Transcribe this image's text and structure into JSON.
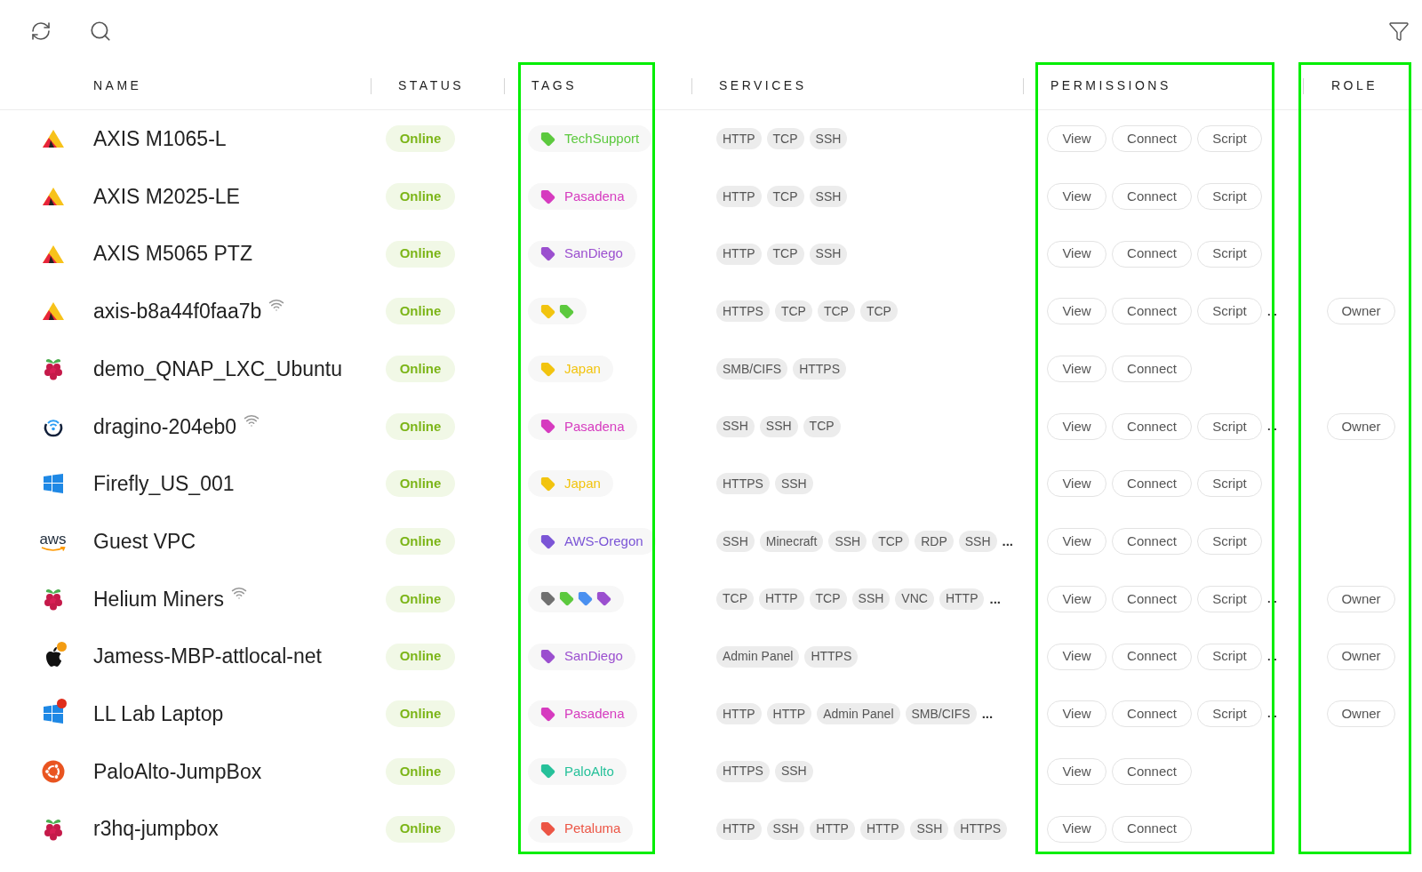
{
  "columns": [
    {
      "label": "NAME",
      "highlighted": false
    },
    {
      "label": "STATUS",
      "highlighted": false
    },
    {
      "label": "TAGS",
      "highlighted": true
    },
    {
      "label": "SERVICES",
      "highlighted": false
    },
    {
      "label": "PERMISSIONS",
      "highlighted": true
    },
    {
      "label": "ROLE",
      "highlighted": true
    }
  ],
  "rows": [
    {
      "kind": "axis",
      "name": "AXIS M1065-L",
      "wireless": false,
      "status": "Online",
      "tags": [
        {
          "label": "TechSupport",
          "color": "#5cc93e"
        }
      ],
      "services": [
        "HTTP",
        "TCP",
        "SSH"
      ],
      "permissions": [
        "View",
        "Connect",
        "Script"
      ]
    },
    {
      "kind": "axis",
      "name": "AXIS M2025-LE",
      "wireless": false,
      "status": "Online",
      "tags": [
        {
          "label": "Pasadena",
          "color": "#d63bbf"
        }
      ],
      "services": [
        "HTTP",
        "TCP",
        "SSH"
      ],
      "permissions": [
        "View",
        "Connect",
        "Script"
      ]
    },
    {
      "kind": "axis",
      "name": "AXIS M5065 PTZ",
      "wireless": false,
      "status": "Online",
      "tags": [
        {
          "label": "SanDiego",
          "color": "#9b4fcf"
        }
      ],
      "services": [
        "HTTP",
        "TCP",
        "SSH"
      ],
      "permissions": [
        "View",
        "Connect",
        "Script"
      ]
    },
    {
      "kind": "axis",
      "name": "axis-b8a44f0faa7b",
      "wireless": true,
      "status": "Online",
      "tags": [
        {
          "color": "#f2c40f"
        },
        {
          "color": "#5cc93e"
        }
      ],
      "services": [
        "HTTPS",
        "TCP",
        "TCP",
        "TCP"
      ],
      "permissions": [
        "View",
        "Connect",
        "Script"
      ],
      "permissions_more": ". .",
      "role": "Owner"
    },
    {
      "kind": "raspberry",
      "name": "demo_QNAP_LXC_Ubuntu",
      "wireless": false,
      "status": "Online",
      "tags": [
        {
          "label": "Japan",
          "color": "#f2c40f"
        }
      ],
      "services": [
        "SMB/CIFS",
        "HTTPS"
      ],
      "permissions": [
        "View",
        "Connect"
      ]
    },
    {
      "kind": "dragino",
      "name": "dragino-204eb0",
      "wireless": true,
      "status": "Online",
      "tags": [
        {
          "label": "Pasadena",
          "color": "#d63bbf"
        }
      ],
      "services": [
        "SSH",
        "SSH",
        "TCP"
      ],
      "permissions": [
        "View",
        "Connect",
        "Script"
      ],
      "permissions_more": ". .",
      "role": "Owner"
    },
    {
      "kind": "windows",
      "name": "Firefly_US_001",
      "wireless": false,
      "status": "Online",
      "tags": [
        {
          "label": "Japan",
          "color": "#f2c40f"
        }
      ],
      "services": [
        "HTTPS",
        "SSH"
      ],
      "permissions": [
        "View",
        "Connect",
        "Script"
      ]
    },
    {
      "kind": "aws",
      "logo_text": "aws",
      "name": "Guest VPC",
      "wireless": false,
      "status": "Online",
      "tags": [
        {
          "label": "AWS-Oregon",
          "color": "#7b55d6"
        }
      ],
      "services": [
        "SSH",
        "Minecraft",
        "SSH",
        "TCP",
        "RDP",
        "SSH"
      ],
      "services_more": "...",
      "permissions": [
        "View",
        "Connect",
        "Script"
      ]
    },
    {
      "kind": "raspberry",
      "name": "Helium Miners",
      "wireless": true,
      "status": "Online",
      "tags": [
        {
          "color": "#707070"
        },
        {
          "color": "#5cc93e"
        },
        {
          "color": "#4a90f0"
        },
        {
          "color": "#9b4fcf"
        }
      ],
      "services": [
        "TCP",
        "HTTP",
        "TCP",
        "SSH",
        "VNC",
        "HTTP"
      ],
      "services_more": "...",
      "permissions": [
        "View",
        "Connect",
        "Script"
      ],
      "permissions_more": ". .",
      "role": "Owner"
    },
    {
      "kind": "apple",
      "color": "#f39c12",
      "name": "Jamess-MBP-attlocal-net",
      "wireless": false,
      "status": "Online",
      "tags": [
        {
          "label": "SanDiego",
          "color": "#9b4fcf"
        }
      ],
      "services": [
        "Admin Panel",
        "HTTPS"
      ],
      "permissions": [
        "View",
        "Connect",
        "Script"
      ],
      "permissions_more": ". .",
      "role": "Owner"
    },
    {
      "kind": "windows",
      "color": "#e02d1b",
      "name": "LL Lab Laptop",
      "wireless": false,
      "status": "Online",
      "tags": [
        {
          "label": "Pasadena",
          "color": "#d63bbf"
        }
      ],
      "services": [
        "HTTP",
        "HTTP",
        "Admin Panel",
        "SMB/CIFS"
      ],
      "services_more": "...",
      "permissions": [
        "View",
        "Connect",
        "Script"
      ],
      "permissions_more": ". .",
      "role": "Owner"
    },
    {
      "kind": "ubuntu",
      "name": "PaloAlto-JumpBox",
      "wireless": false,
      "status": "Online",
      "tags": [
        {
          "label": "PaloAlto",
          "color": "#26c19a"
        }
      ],
      "services": [
        "HTTPS",
        "SSH"
      ],
      "permissions": [
        "View",
        "Connect"
      ]
    },
    {
      "kind": "raspberry",
      "name": "r3hq-jumpbox",
      "wireless": false,
      "status": "Online",
      "tags": [
        {
          "label": "Petaluma",
          "color": "#ec5545"
        }
      ],
      "services": [
        "HTTP",
        "SSH",
        "HTTP",
        "HTTP",
        "SSH",
        "HTTPS"
      ],
      "permissions": [
        "View",
        "Connect"
      ]
    }
  ]
}
